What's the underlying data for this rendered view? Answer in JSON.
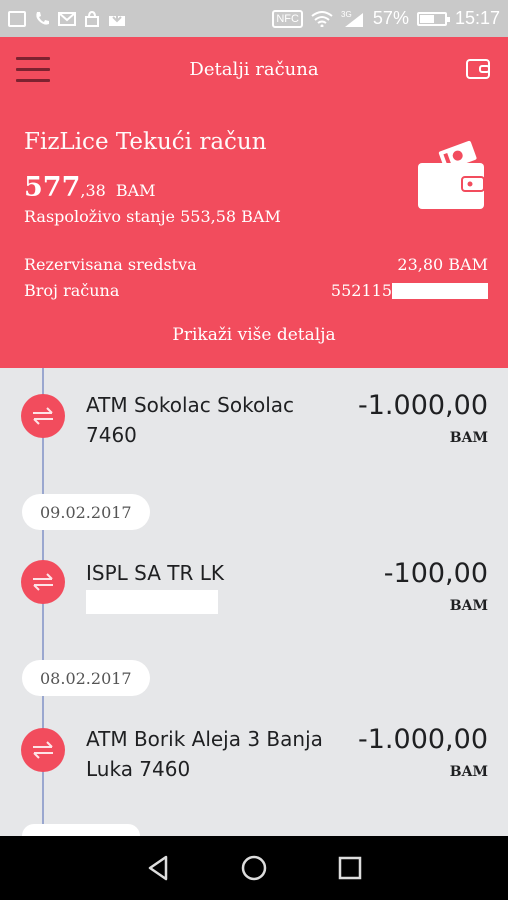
{
  "status_bar": {
    "battery": "57%",
    "time": "15:17",
    "network": "3G",
    "nfc": "NFC"
  },
  "header": {
    "title": "Detalji računa",
    "account_name": "FizLice Tekući račun",
    "balance_int": "577",
    "balance_dec": ",38",
    "currency": "BAM",
    "available": "Raspoloživo stanje 553,58 BAM",
    "reserved_label": "Rezervisana sredstva",
    "reserved_value": "23,80 BAM",
    "account_number_label": "Broj računa",
    "account_number_prefix": "552115",
    "more_details": "Prikaži više detalja",
    "accent": "#f24c5d"
  },
  "transactions": [
    {
      "description": "ATM Sokolac Sokolac 7460",
      "amount": "-1.000,00",
      "currency": "BAM"
    },
    {
      "description": "ISPL SA TR LK",
      "amount": "-100,00",
      "currency": "BAM"
    },
    {
      "description": "ATM Borik Aleja 3 Banja Luka 7460",
      "amount": "-1.000,00",
      "currency": "BAM"
    }
  ],
  "dates": [
    "09.02.2017",
    "08.02.2017"
  ],
  "icons": {
    "menu": "hamburger-icon",
    "wallet": "wallet-icon",
    "transfer": "transfer-arrows-icon"
  }
}
